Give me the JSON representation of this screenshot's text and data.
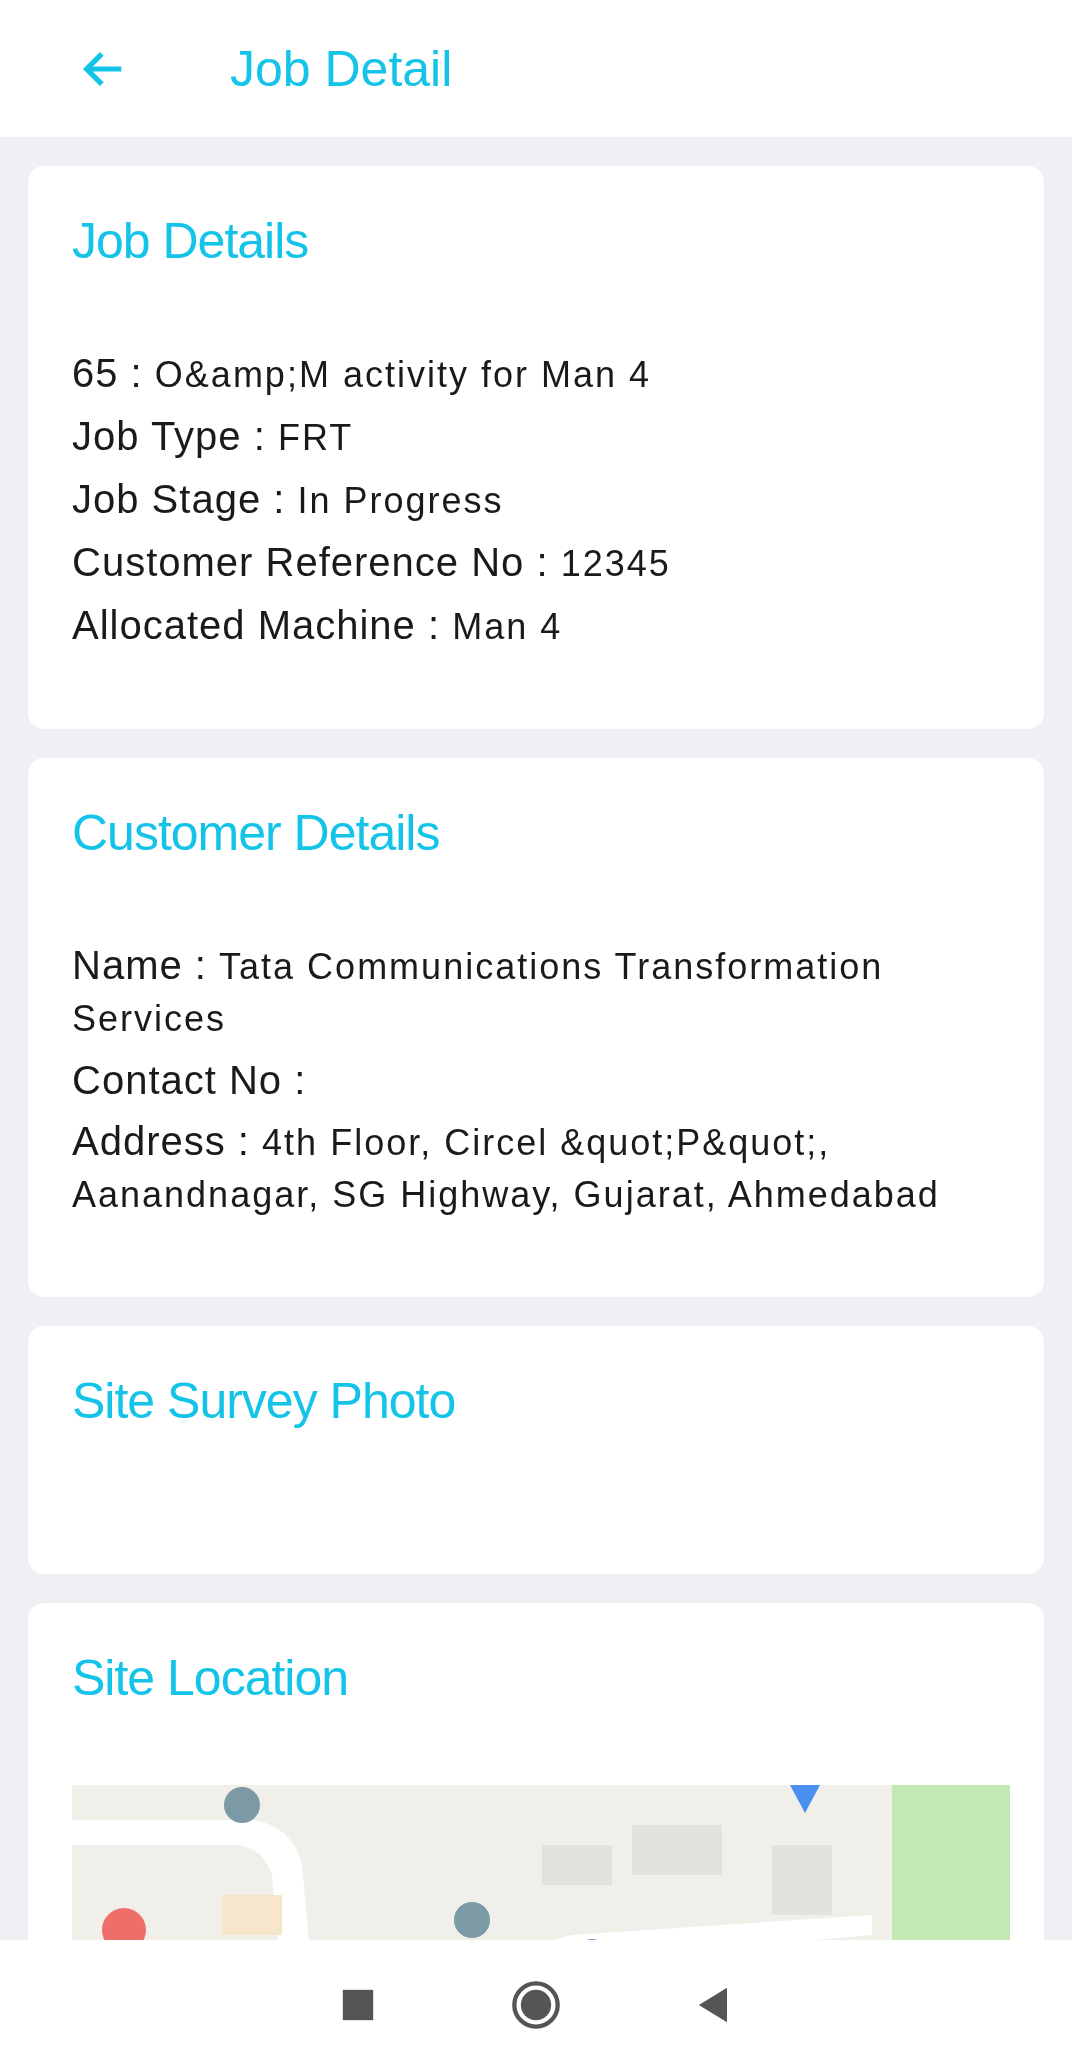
{
  "app_bar": {
    "title": "Job Detail"
  },
  "cards": [
    {
      "kind": "fields",
      "title": "Job Details",
      "fields": [
        {
          "label": "65 :",
          "value": "O&amp;M activity for Man 4"
        },
        {
          "label": "Job Type :",
          "value": "FRT"
        },
        {
          "label": "Job Stage :",
          "value": "In Progress"
        },
        {
          "label": "Customer Reference No :",
          "value": "12345"
        },
        {
          "label": "Allocated Machine :",
          "value": "Man 4"
        }
      ]
    },
    {
      "kind": "fields",
      "title": "Customer Details",
      "fields": [
        {
          "label": "Name :",
          "value": "Tata Communications Transformation Services"
        },
        {
          "label": "Contact No :"
        },
        {
          "label": "Address :",
          "value": "4th Floor, Circel &quot;P&quot;, Aanandnagar, SG Highway, Gujarat, Ahmedabad"
        }
      ]
    },
    {
      "kind": "empty",
      "title": "Site Survey Photo"
    },
    {
      "kind": "map",
      "title": "Site Location"
    }
  ]
}
